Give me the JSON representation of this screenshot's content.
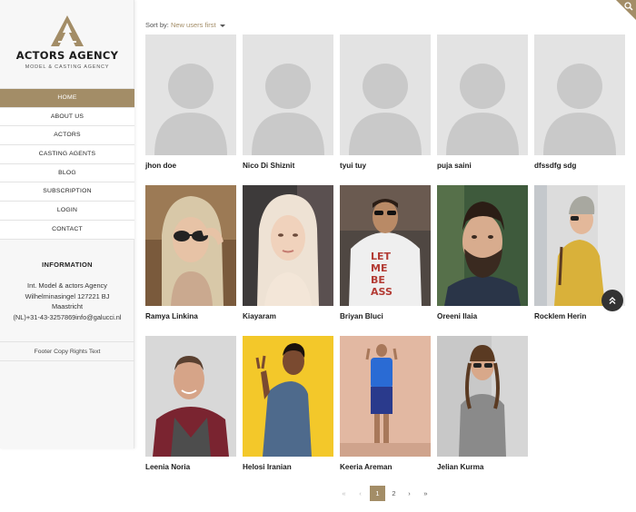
{
  "brand": {
    "name": "ACTORS AGENCY",
    "tagline": "MODEL & CASTING AGENCY"
  },
  "nav": {
    "items": [
      "HOME",
      "ABOUT US",
      "ACTORS",
      "CASTING AGENTS",
      "BLOG",
      "SUBSCRIPTION",
      "LOGIN",
      "CONTACT"
    ],
    "active_index": 0
  },
  "information": {
    "heading": "INFORMATION",
    "line1": "Int. Model & actors Agency",
    "line2": "Wilhelminasingel 127221 BJ",
    "line3": "Maastricht",
    "line4": "(NL)+31-43-3257869info@galucci.nl"
  },
  "footer": {
    "text": "Footer Copy Rights Text"
  },
  "sort": {
    "label": "Sort by:",
    "value": "New users first"
  },
  "users": [
    {
      "name": "jhon doe",
      "photo": "placeholder-avatar"
    },
    {
      "name": "Nico Di Shiznit",
      "photo": "placeholder-avatar"
    },
    {
      "name": "tyui tuy",
      "photo": "placeholder-avatar"
    },
    {
      "name": "puja saini",
      "photo": "placeholder-avatar"
    },
    {
      "name": "dfssdfg sdg",
      "photo": "placeholder-avatar"
    },
    {
      "name": "Ramya Linkina",
      "photo": "blonde-woman-sunglasses"
    },
    {
      "name": "Kiayaram",
      "photo": "blonde-woman-portrait"
    },
    {
      "name": "Briyan Bluci",
      "photo": "man-sunglasses-tshirt"
    },
    {
      "name": "Oreeni Ilaia",
      "photo": "bearded-man-portrait"
    },
    {
      "name": "Rocklem Herin",
      "photo": "woman-beanie-yellow-sweater"
    },
    {
      "name": "Leenia Noria",
      "photo": "bald-man-vest"
    },
    {
      "name": "Helosi Iranian",
      "photo": "woman-yellow-background-peace-sign"
    },
    {
      "name": "Keeria Areman",
      "photo": "man-blue-shirt-full-body"
    },
    {
      "name": "Jelian Kurma",
      "photo": "woman-braids-sunglasses"
    }
  ],
  "pagination": {
    "first": "«",
    "prev": "‹",
    "pages": [
      "1",
      "2"
    ],
    "current": "1",
    "next": "›",
    "last": "»"
  },
  "colors": {
    "accent": "#a38d67",
    "sidebar_bg": "#f7f7f7",
    "placeholder_bg": "#e3e3e3",
    "placeholder_fg": "#c9c9c9",
    "scroll_top_bg": "#333333"
  },
  "icons": {
    "scroll_top": "chevron-double-up-icon",
    "corner": "search-icon"
  }
}
